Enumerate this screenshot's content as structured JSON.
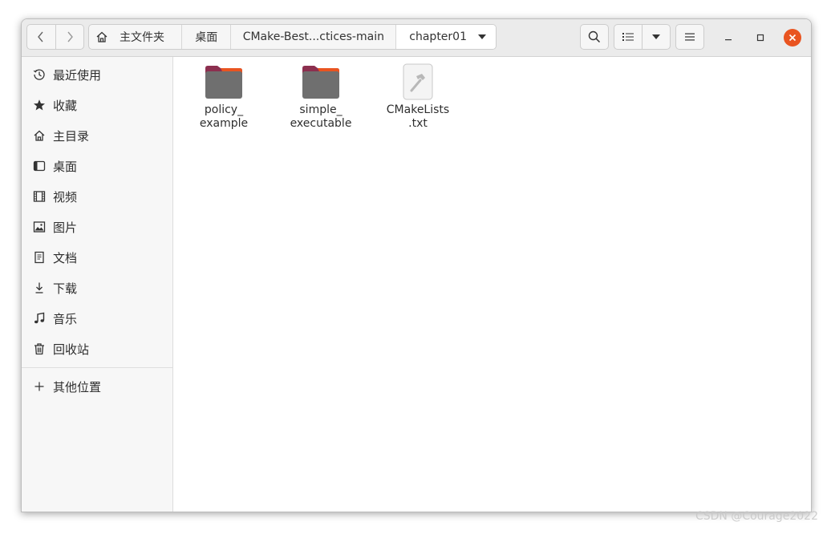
{
  "header": {
    "breadcrumbs": [
      "主文件夹",
      "桌面",
      "CMake-Best...ctices-main",
      "chapter01"
    ]
  },
  "sidebar": {
    "items": [
      {
        "label": "最近使用",
        "icon": "clock-icon"
      },
      {
        "label": "收藏",
        "icon": "star-icon"
      },
      {
        "label": "主目录",
        "icon": "home-icon"
      },
      {
        "label": "桌面",
        "icon": "desktop-icon"
      },
      {
        "label": "视频",
        "icon": "film-icon"
      },
      {
        "label": "图片",
        "icon": "image-icon"
      },
      {
        "label": "文档",
        "icon": "document-icon"
      },
      {
        "label": "下载",
        "icon": "download-icon"
      },
      {
        "label": "音乐",
        "icon": "music-icon"
      },
      {
        "label": "回收站",
        "icon": "trash-icon"
      }
    ],
    "other_locations": {
      "label": "其他位置",
      "icon": "plus-icon"
    }
  },
  "files": [
    {
      "line1": "policy_",
      "line2": "example",
      "type": "folder"
    },
    {
      "line1": "simple_",
      "line2": "executable",
      "type": "folder"
    },
    {
      "line1": "CMakeLists",
      "line2": ".txt",
      "type": "text-file"
    }
  ],
  "watermark": "CSDN @Courage2022",
  "colors": {
    "accent": "#e95420",
    "folder_tab": "#8c2f4f",
    "folder_body": "#6f6f6f"
  }
}
